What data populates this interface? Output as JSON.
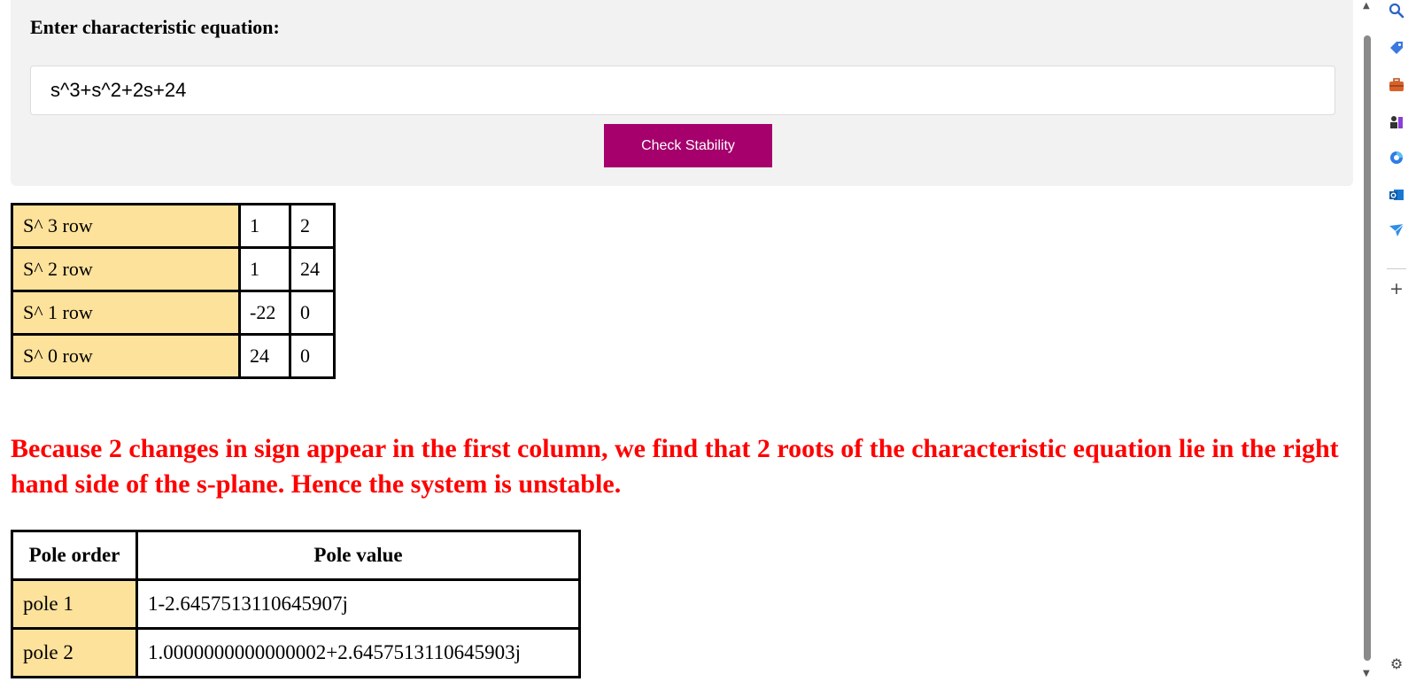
{
  "form": {
    "label": "Enter characteristic equation:",
    "equation_value": "s^3+s^2+2s+24",
    "button_label": "Check Stability",
    "button_color": "#a5006c"
  },
  "routh_table": {
    "rows": [
      {
        "label": "S^ 3 row",
        "col1": "1",
        "col2": "2"
      },
      {
        "label": "S^ 2 row",
        "col1": "1",
        "col2": "24"
      },
      {
        "label": "S^ 1 row",
        "col1": "-22",
        "col2": "0"
      },
      {
        "label": "S^ 0 row",
        "col1": "24",
        "col2": "0"
      }
    ],
    "label_bg_color": "#fde29c"
  },
  "result": {
    "message": "Because 2 changes in sign appear in the first column, we find that 2 roots of the characteristic equation lie in the right hand side of the s-plane. Hence the system is unstable.",
    "color": "#ff0000"
  },
  "pole_table": {
    "headers": [
      "Pole order",
      "Pole value"
    ],
    "rows": [
      {
        "order": "pole 1",
        "value": "1-2.6457513110645907j"
      },
      {
        "order": "pole 2",
        "value": "1.0000000000000002+2.6457513110645903j"
      }
    ]
  },
  "browser_sidebar": {
    "icons": [
      "search-icon",
      "tag-icon",
      "briefcase-icon",
      "chess-icon",
      "copilot-icon",
      "outlook-icon",
      "send-icon",
      "plus-icon",
      "settings-icon"
    ],
    "add_symbol": "+",
    "settings_symbol": "⚙"
  }
}
